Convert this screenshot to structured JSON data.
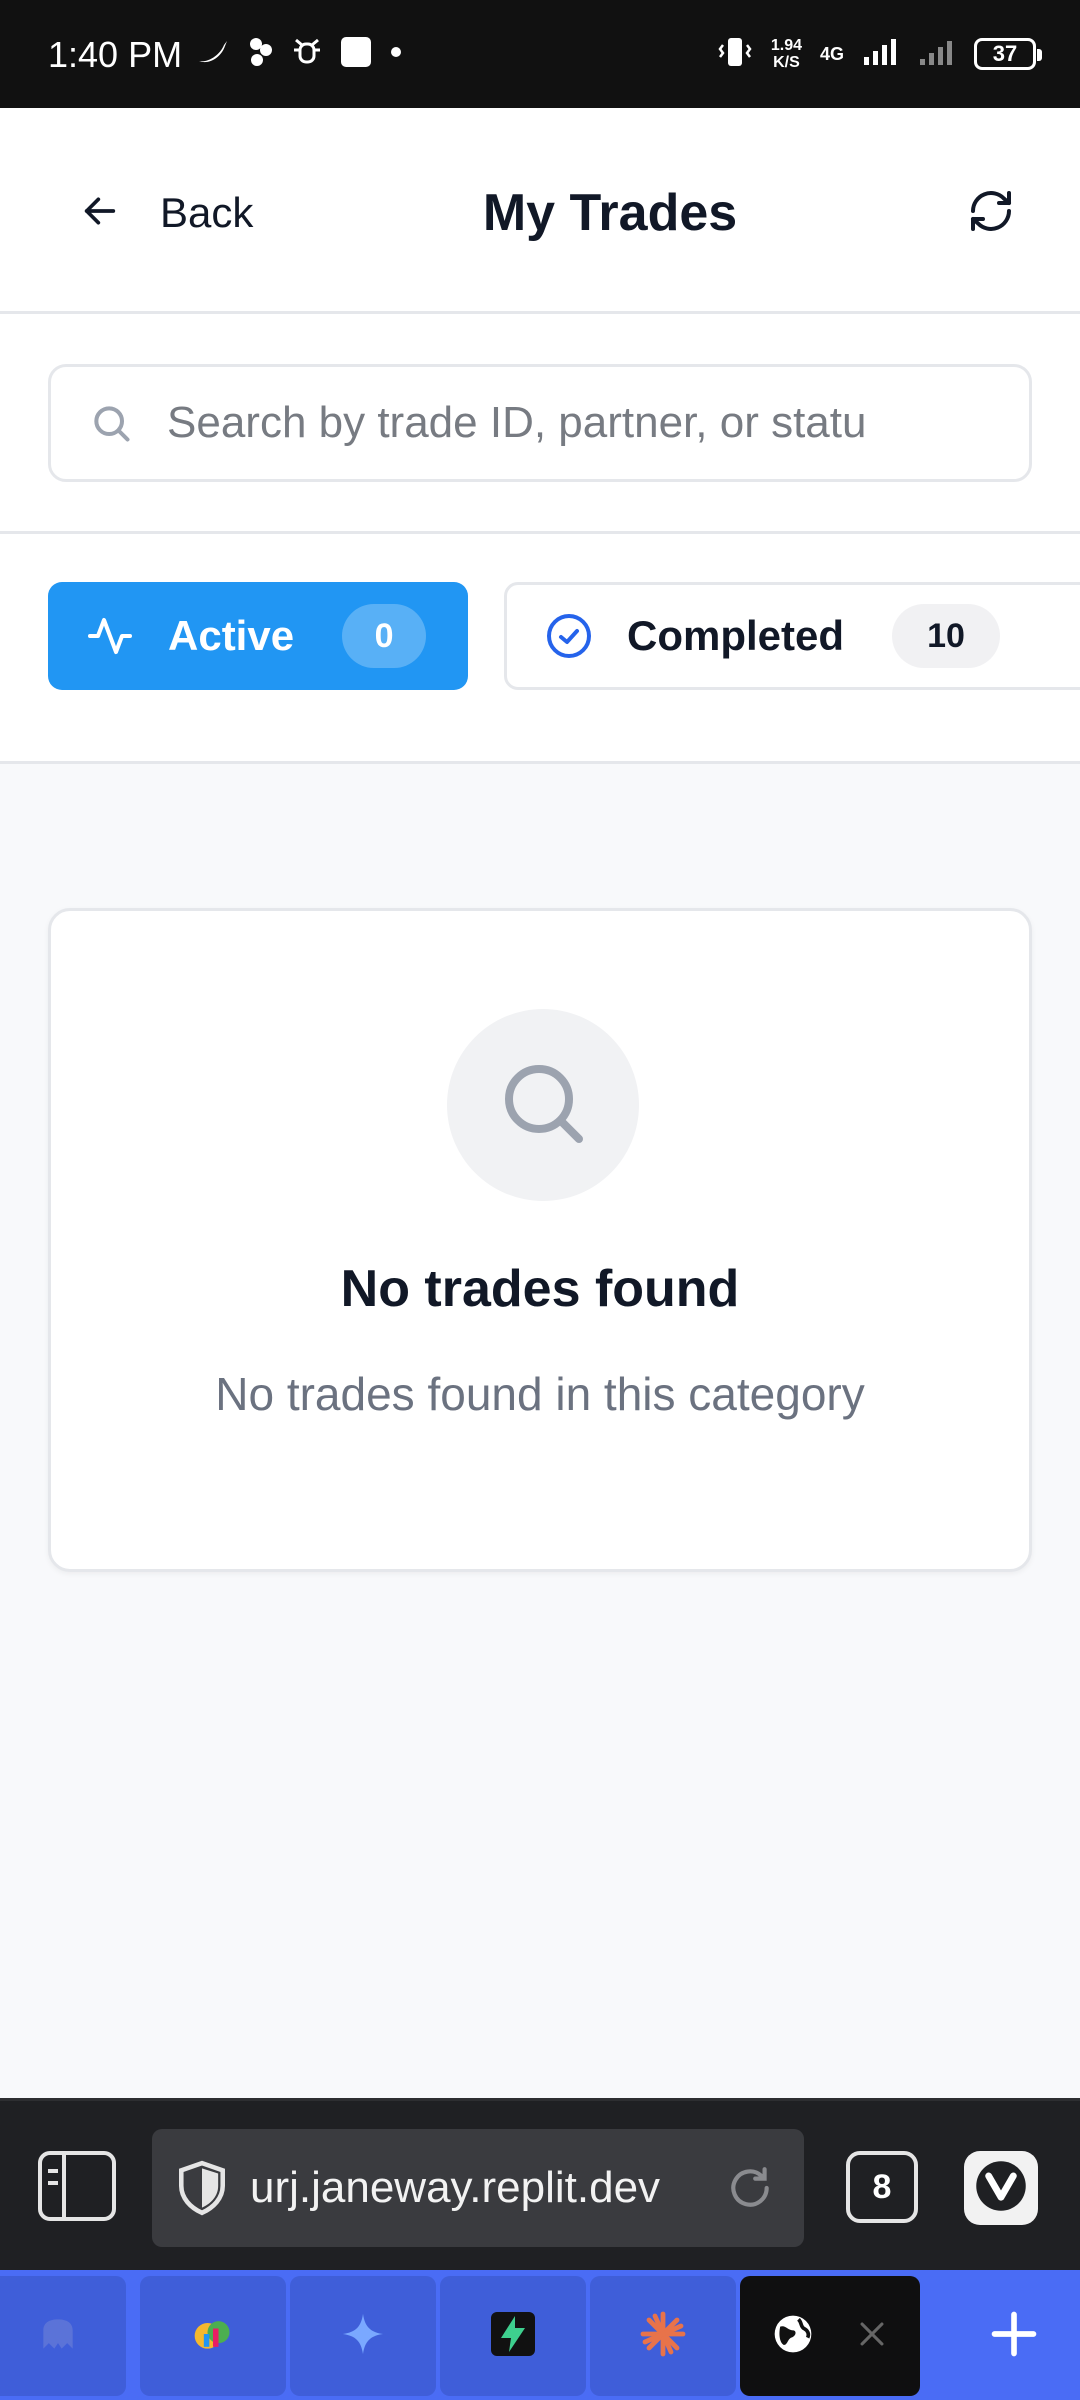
{
  "status_bar": {
    "time": "1:40 PM",
    "net_speed_value": "1.94",
    "net_speed_unit": "K/S",
    "network_type": "4G",
    "battery": "37"
  },
  "header": {
    "back_label": "Back",
    "title": "My Trades",
    "icons": {
      "back": "arrow-left-icon",
      "refresh": "refresh-icon"
    }
  },
  "search": {
    "placeholder": "Search by trade ID, partner, or statu",
    "value": ""
  },
  "tabs": [
    {
      "label": "Active",
      "count": "0",
      "icon": "activity-icon",
      "selected": true
    },
    {
      "label": "Completed",
      "count": "10",
      "icon": "check-circle-icon",
      "selected": false
    }
  ],
  "empty_state": {
    "icon": "search-icon",
    "title": "No trades found",
    "subtitle": "No trades found in this category"
  },
  "browser": {
    "url": "urj.janeway.replit.dev",
    "tab_count": "8"
  },
  "colors": {
    "accent": "#2196f3",
    "tabstrip": "#4a6cf5",
    "text_primary": "#111827",
    "text_muted": "#6b7280"
  }
}
